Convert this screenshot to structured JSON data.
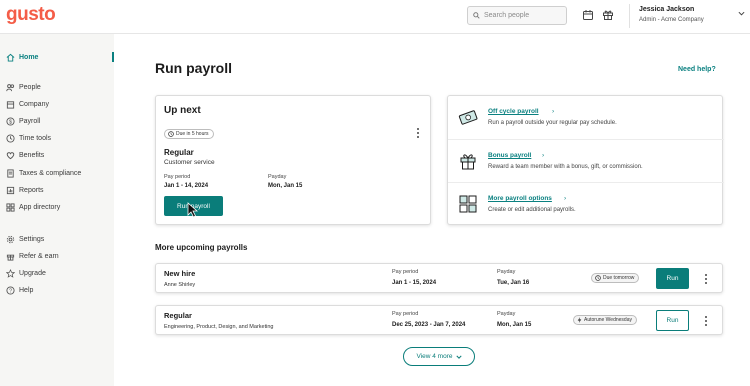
{
  "app": {
    "logo": "gusto"
  },
  "header": {
    "search_placeholder": "Search people",
    "user_name": "Jessica Jackson",
    "user_role": "Admin - Acme Company"
  },
  "sidebar": {
    "items": [
      {
        "label": "Home",
        "icon": "home-icon",
        "active": true
      },
      {
        "label": "People",
        "icon": "people-icon"
      },
      {
        "label": "Company",
        "icon": "company-icon"
      },
      {
        "label": "Payroll",
        "icon": "payroll-icon"
      },
      {
        "label": "Time tools",
        "icon": "clock-icon"
      },
      {
        "label": "Benefits",
        "icon": "heart-icon"
      },
      {
        "label": "Taxes & compliance",
        "icon": "document-icon"
      },
      {
        "label": "Reports",
        "icon": "reports-icon"
      },
      {
        "label": "App directory",
        "icon": "grid-icon"
      },
      {
        "label": "Settings",
        "icon": "gear-icon"
      },
      {
        "label": "Refer & earn",
        "icon": "gift-icon"
      },
      {
        "label": "Upgrade",
        "icon": "star-icon"
      },
      {
        "label": "Help",
        "icon": "help-icon"
      }
    ]
  },
  "main": {
    "title": "Run payroll",
    "help_link": "Need help?",
    "up_next": {
      "heading": "Up next",
      "due_badge": "Due in 5 hours",
      "name": "Regular",
      "subtitle": "Customer service",
      "pay_period_label": "Pay period",
      "pay_period": "Jan 1 - 14, 2024",
      "payday_label": "Payday",
      "payday": "Mon, Jan 15",
      "button": "Run payroll"
    },
    "options": [
      {
        "title": "Off cycle payroll",
        "desc": "Run a payroll outside your regular pay schedule.",
        "icon": "off-cycle-icon"
      },
      {
        "title": "Bonus payroll",
        "desc": "Reward a team member with a bonus, gift, or commission.",
        "icon": "bonus-gift-icon"
      },
      {
        "title": "More payroll options",
        "desc": "Create or edit additional payrolls.",
        "icon": "more-options-icon"
      }
    ],
    "upcoming_title": "More upcoming payrolls",
    "upcoming": [
      {
        "name": "New hire",
        "sub": "Anne Shirley",
        "pay_period_label": "Pay period",
        "pay_period": "Jan 1 - 15, 2024",
        "payday_label": "Payday",
        "payday": "Tue, Jan 16",
        "badge": "Due tomorrow",
        "button": "Run"
      },
      {
        "name": "Regular",
        "sub": "Engineering, Product, Design, and Marketing",
        "pay_period_label": "Pay period",
        "pay_period": "Dec 25, 2023 - Jan 7, 2024",
        "payday_label": "Payday",
        "payday": "Mon, Jan 15",
        "badge": "Autorune Wednesday",
        "button": "Run"
      }
    ],
    "view_more": "View 4 more"
  },
  "colors": {
    "brand": "#f45d48",
    "accent": "#0a7d7a",
    "sidebar_bg": "#f6f6f4"
  }
}
